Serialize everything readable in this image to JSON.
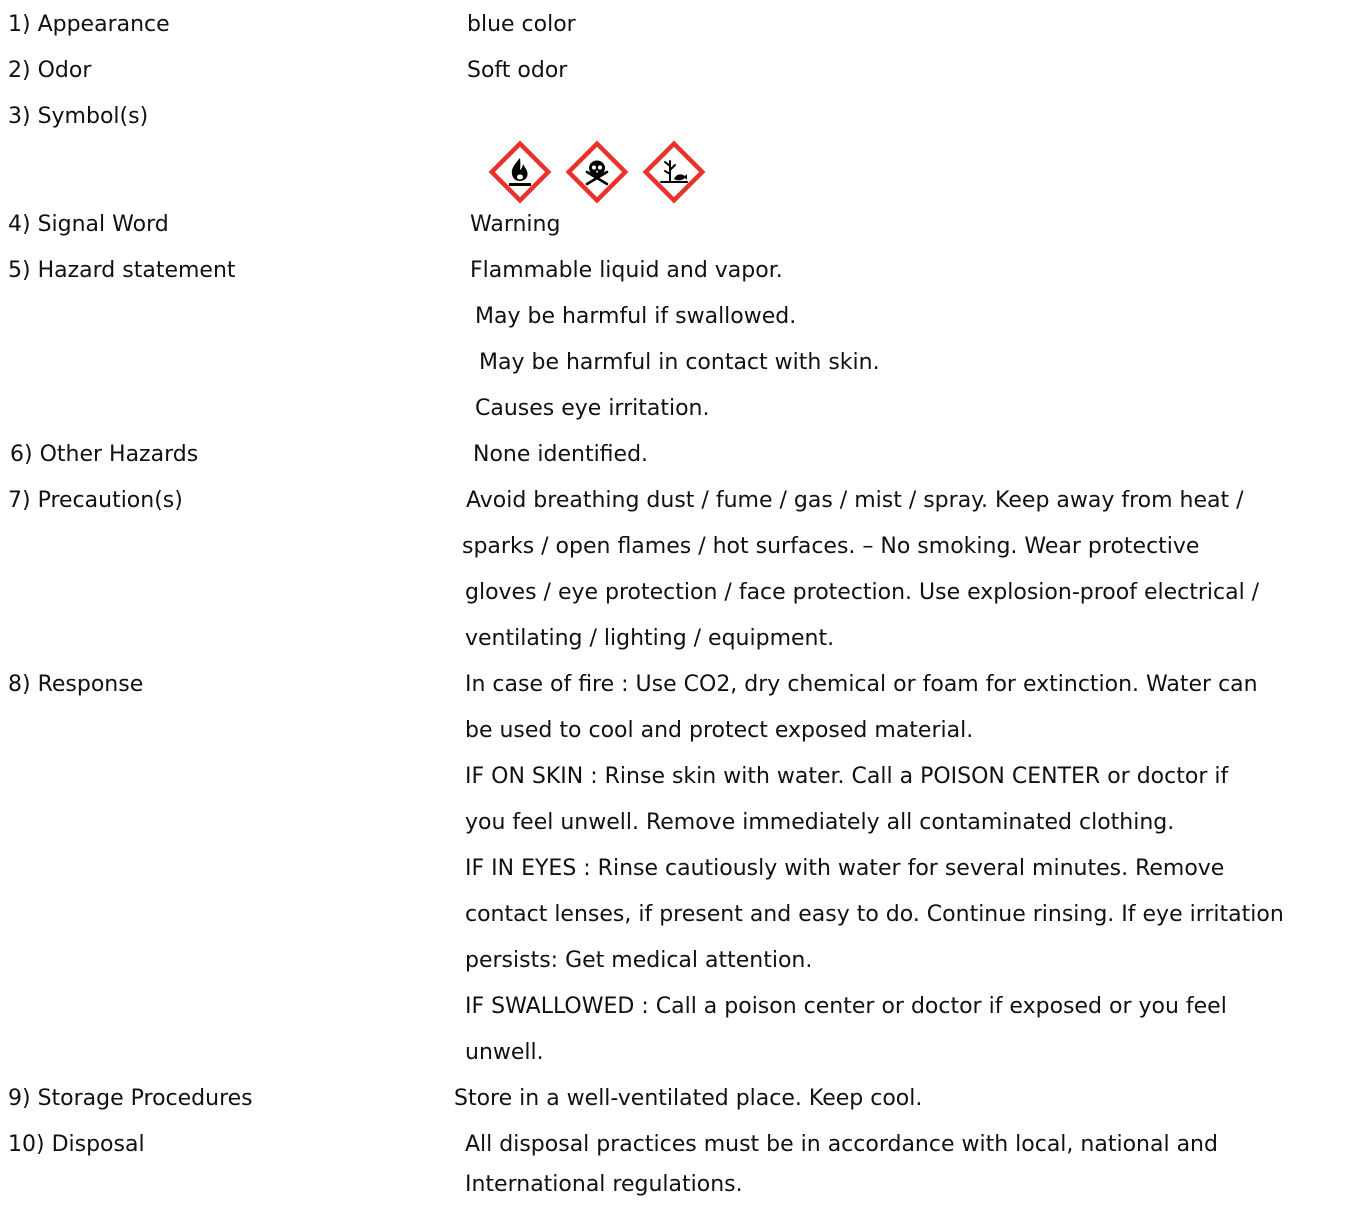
{
  "rows": {
    "appearance": {
      "label": "1) Appearance",
      "value": "blue color"
    },
    "odor": {
      "label": "2) Odor",
      "value": "Soft odor"
    },
    "symbols": {
      "label": "3) Symbol(s)",
      "pictograms": [
        "flame-pictogram",
        "skull-crossbones-pictogram",
        "environment-pictogram"
      ]
    },
    "signal_word": {
      "label": "4) Signal Word",
      "value": "Warning"
    },
    "hazard_statement": {
      "label": "5) Hazard statement",
      "lines": [
        "Flammable liquid and vapor.",
        "May be harmful if swallowed.",
        "May be harmful in contact with skin.",
        "Causes eye irritation."
      ]
    },
    "other_hazards": {
      "label": "6) Other Hazards",
      "value": "None identified."
    },
    "precautions": {
      "label": "7) Precaution(s)",
      "lines": [
        "Avoid breathing dust / fume / gas / mist / spray. Keep away from heat /",
        "sparks / open flames / hot surfaces. – No smoking. Wear protective",
        "gloves / eye protection / face protection. Use explosion-proof electrical /",
        "ventilating / lighting / equipment."
      ]
    },
    "response": {
      "label": "8) Response",
      "lines": [
        "In case of fire : Use CO2, dry chemical or foam for extinction. Water can",
        "be used to cool and protect exposed material.",
        "IF ON SKIN : Rinse skin with water. Call a POISON CENTER or doctor if",
        "you feel unwell. Remove immediately all contaminated clothing.",
        "IF IN EYES : Rinse cautiously with water for several minutes. Remove",
        "contact lenses, if present and easy to do. Continue rinsing. If eye irritation",
        "persists: Get medical attention.",
        "IF SWALLOWED : Call a poison center or doctor if exposed or you feel",
        "unwell."
      ]
    },
    "storage": {
      "label": "9) Storage Procedures",
      "value": "Store in a well-ventilated place. Keep cool."
    },
    "disposal": {
      "label": "10) Disposal",
      "lines": [
        "All disposal practices must be in accordance with local, national and",
        "International regulations."
      ]
    }
  },
  "colors": {
    "pictogram_border": "#e8322b",
    "pictogram_symbol": "#000000"
  }
}
